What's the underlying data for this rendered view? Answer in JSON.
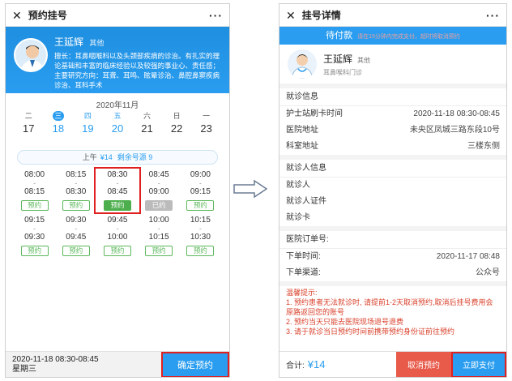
{
  "left": {
    "title": "预约挂号",
    "more": "···",
    "doctor": {
      "name": "王延辉",
      "tag": "其他",
      "intro": "擅长：耳鼻咽喉科以及头颈部疾病的诊治。有扎实的理论基础和丰富的临床经验以及较强的事业心、责任感；主要研究方向：耳聋、耳鸣、眩晕诊治、鼻腔鼻窦疾病诊治、耳科手术"
    },
    "month": "2020年11月",
    "days": [
      {
        "wd": "二",
        "dn": "17"
      },
      {
        "wd": "三",
        "dn": "18"
      },
      {
        "wd": "四",
        "dn": "19"
      },
      {
        "wd": "五",
        "dn": "20"
      },
      {
        "wd": "六",
        "dn": "21"
      },
      {
        "wd": "日",
        "dn": "22"
      },
      {
        "wd": "一",
        "dn": "23"
      }
    ],
    "period": {
      "label": "上午",
      "price": "¥14",
      "remain": "剩余号源 9"
    },
    "slots": [
      {
        "start": "08:00",
        "end": "08:15",
        "btn": "预约"
      },
      {
        "start": "08:15",
        "end": "08:30",
        "btn": "预约"
      },
      {
        "start": "08:30",
        "end": "08:45",
        "btn": "预约"
      },
      {
        "start": "08:45",
        "end": "09:00",
        "btn": "已约"
      },
      {
        "start": "09:00",
        "end": "09:15",
        "btn": "预约"
      },
      {
        "start": "09:15",
        "end": "09:30",
        "btn": "预约"
      },
      {
        "start": "09:30",
        "end": "09:45",
        "btn": "预约"
      },
      {
        "start": "09:45",
        "end": "10:00",
        "btn": "预约"
      },
      {
        "start": "10:00",
        "end": "10:15",
        "btn": "预约"
      },
      {
        "start": "10:15",
        "end": "10:30",
        "btn": "预约"
      }
    ],
    "dash": "-",
    "bottom": {
      "datetime": "2020-11-18   08:30-08:45",
      "weekday": "星期三",
      "confirm": "确定预约"
    }
  },
  "right": {
    "title": "挂号详情",
    "more": "···",
    "status": "待付款",
    "status_hint": "请在15分钟内完成支付，超时将取消预约",
    "doctor": {
      "name": "王延辉",
      "tag": "其他",
      "dept": "耳鼻喉科门诊"
    },
    "visit_info_title": "就诊信息",
    "visit_rows": [
      {
        "k": "护士站刷卡时间",
        "v": "2020-11-18 08:30-08:45"
      },
      {
        "k": "医院地址",
        "v": "未央区凤城三路东段10号"
      },
      {
        "k": "科室地址",
        "v": "三楼东侧"
      }
    ],
    "patient_info_title": "就诊人信息",
    "patient_rows": [
      {
        "k": "就诊人",
        "v": ""
      },
      {
        "k": "就诊人证件",
        "v": ""
      },
      {
        "k": "就诊卡",
        "v": ""
      }
    ],
    "order_title": "医院订单号:",
    "order_rows": [
      {
        "k": "下单时间:",
        "v": "2020-11-17 08:48"
      },
      {
        "k": "下单渠道:",
        "v": "公众号"
      }
    ],
    "tips_title": "温馨提示:",
    "tips": [
      "1. 预约患者无法就诊时, 请提前1-2天取消预约,取消后挂号费用会原路返回您的账号",
      "2. 预约当天只能去医院现场退号退费",
      "3. 请于就诊当日预约时间前携带预约身份证前往预约"
    ],
    "total_label": "合计:",
    "total_amount": "¥14",
    "cancel": "取消预约",
    "pay": "立即支付"
  }
}
